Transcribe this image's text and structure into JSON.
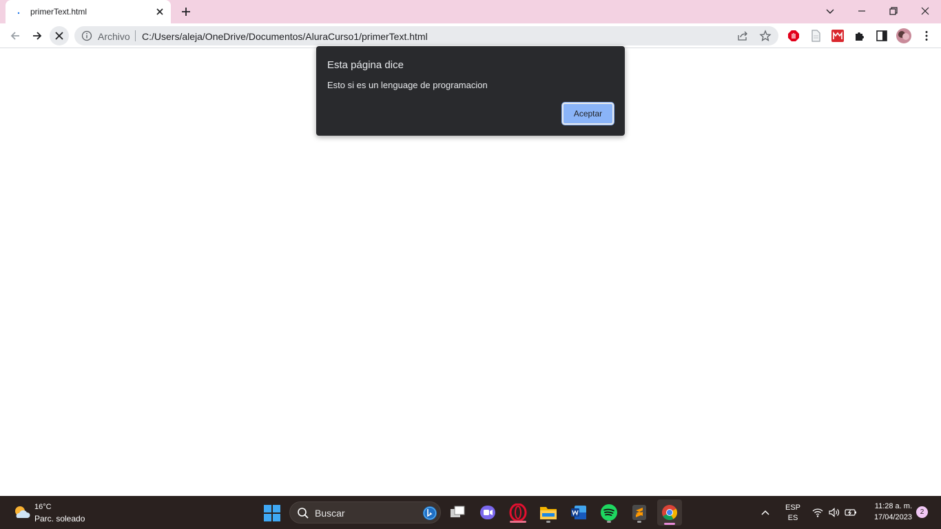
{
  "browser": {
    "tab": {
      "title": "primerText.html"
    },
    "omnibox": {
      "scheme_label": "Archivo",
      "url": "C:/Users/aleja/OneDrive/Documentos/AluraCurso1/primerText.html"
    }
  },
  "dialog": {
    "title": "Esta página dice",
    "message": "Esto si es un lenguage de programacion",
    "ok_label": "Aceptar"
  },
  "taskbar": {
    "weather": {
      "temperature": "16°C",
      "description": "Parc. soleado"
    },
    "search": {
      "placeholder": "Buscar"
    },
    "apps": [
      "task-view",
      "teams-chat",
      "opera",
      "file-explorer",
      "word",
      "spotify",
      "sublime-text",
      "chrome"
    ],
    "language": {
      "line1": "ESP",
      "line2": "ES"
    },
    "clock": {
      "time": "11:28 a. m.",
      "date": "17/04/2023"
    },
    "notifications": "2"
  },
  "colors": {
    "tabstrip": "#f3d2e2",
    "dialog_bg": "#292a2d",
    "dialog_button": "#8ab4f8",
    "taskbar": "#2a211f"
  }
}
